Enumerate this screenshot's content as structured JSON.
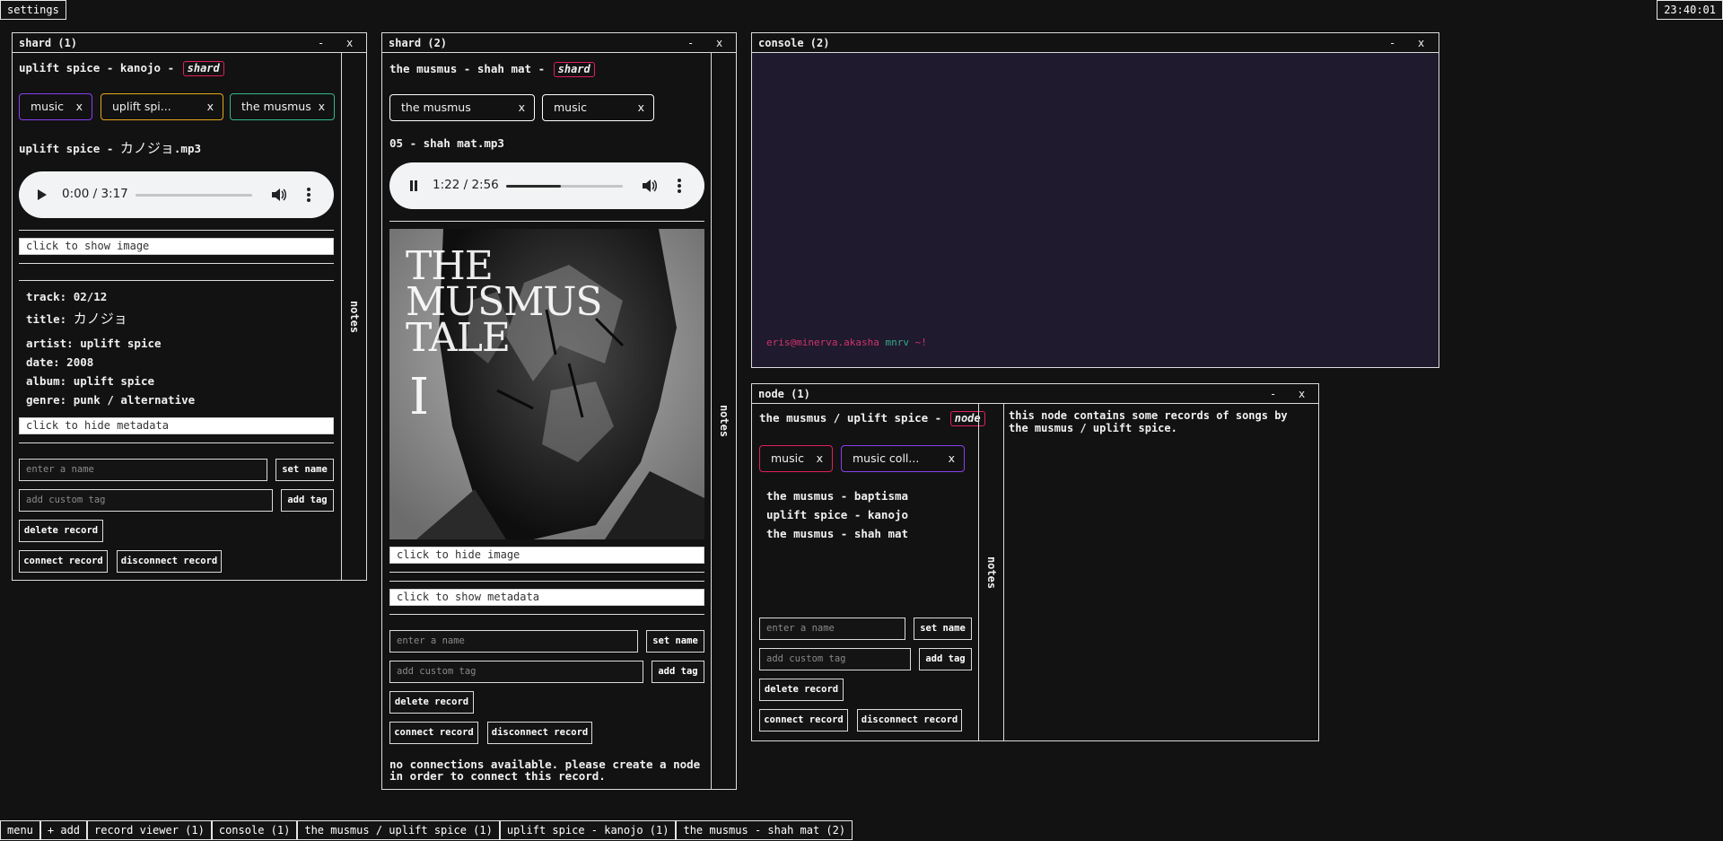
{
  "topbar": {
    "settings_label": "settings",
    "clock": "23:40:01"
  },
  "taskbar": [
    "menu",
    "+ add",
    "record viewer (1)",
    "console (1)",
    "the musmus / uplift spice (1)",
    "uplift spice - kanojo (1)",
    "the musmus - shah mat (2)"
  ],
  "colors": {
    "bg": "#121212",
    "badge": "#e0205a",
    "console_bg": "#1f1a2d",
    "prompt_user": "#d1346c",
    "prompt_host": "#3aa88a"
  },
  "shard1": {
    "title": "shard (1)",
    "minimize": "-",
    "close": "x",
    "record_title": "uplift spice - kanojo -",
    "type_badge": "shard",
    "tags": [
      {
        "label": "music",
        "color": "#8a3ff0"
      },
      {
        "label": "uplift spi...",
        "color": "#e3a817"
      },
      {
        "label": "the musmus",
        "color": "#33b889"
      }
    ],
    "tag_remove": "x",
    "file_prefix": "uplift spice - ",
    "file_jp": "カノジョ",
    "file_ext": ".mp3",
    "audio": {
      "time": "0:00 / 3:17",
      "progress": 0
    },
    "show_image": "click to show image",
    "metadata": {
      "track_label": "track:",
      "track": "02/12",
      "title_label": "title:",
      "title": "カノジョ",
      "artist_label": "artist:",
      "artist": "uplift spice",
      "date_label": "date:",
      "date": "2008",
      "album_label": "album:",
      "album": "uplift spice",
      "genre_label": "genre:",
      "genre": "punk / alternative"
    },
    "hide_metadata": "click to hide metadata",
    "name_placeholder": "enter a name",
    "set_name": "set name",
    "tag_placeholder": "add custom tag",
    "add_tag": "add tag",
    "delete": "delete record",
    "connect": "connect record",
    "disconnect": "disconnect record",
    "notes": "notes"
  },
  "shard2": {
    "title": "shard (2)",
    "minimize": "-",
    "close": "x",
    "record_title": "the musmus - shah mat -",
    "type_badge": "shard",
    "tags": [
      {
        "label": "the musmus",
        "color": "#ffffff"
      },
      {
        "label": "music",
        "color": "#ffffff"
      }
    ],
    "tag_remove": "x",
    "file_name": "05 - shah mat.mp3",
    "audio": {
      "time": "1:22 / 2:56",
      "progress": 0.466
    },
    "cover_text": [
      "THE",
      "MUSMUS",
      "TALE",
      "I"
    ],
    "hide_image": "click to hide image",
    "show_metadata": "click to show metadata",
    "name_placeholder": "enter a name",
    "set_name": "set name",
    "tag_placeholder": "add custom tag",
    "add_tag": "add tag",
    "delete": "delete record",
    "connect": "connect record",
    "disconnect": "disconnect record",
    "no_connections": "no connections available. please create a node in order to connect this record.",
    "notes": "notes"
  },
  "console": {
    "title": "console (2)",
    "minimize": "-",
    "close": "x",
    "prompt_user": "eris@minerva.akasha",
    "prompt_dir": "mnrv",
    "prompt_symbol": "~!"
  },
  "node": {
    "title": "node (1)",
    "minimize": "-",
    "close": "x",
    "record_title": "the musmus / uplift spice -",
    "type_badge": "node",
    "tags": [
      {
        "label": "music",
        "color": "#e0205a"
      },
      {
        "label": "music coll...",
        "color": "#8a3ff0"
      }
    ],
    "tag_remove": "x",
    "children": [
      "the musmus - baptisma",
      "uplift spice - kanojo",
      "the musmus - shah mat"
    ],
    "name_placeholder": "enter a name",
    "set_name": "set name",
    "tag_placeholder": "add custom tag",
    "add_tag": "add tag",
    "delete": "delete record",
    "connect": "connect record",
    "disconnect": "disconnect record",
    "notes": "notes",
    "notes_text": "this node contains some records of songs by the musmus / uplift spice."
  }
}
